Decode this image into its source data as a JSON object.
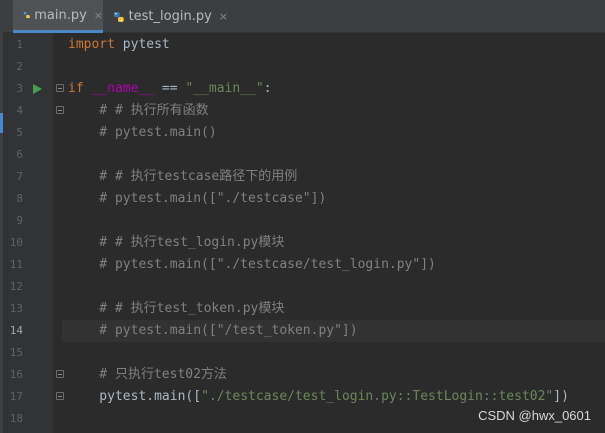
{
  "tabs": [
    {
      "label": "main.py",
      "close": "×",
      "icon": "python-file-icon",
      "active": true
    },
    {
      "label": "test_login.py",
      "close": "×",
      "icon": "python-file-icon",
      "active": false
    }
  ],
  "lines": [
    {
      "n": "1",
      "segs": [
        [
          "kw",
          "import"
        ],
        [
          "t",
          " pytest"
        ]
      ]
    },
    {
      "n": "2",
      "segs": []
    },
    {
      "n": "3",
      "segs": [
        [
          "kw",
          "if"
        ],
        [
          "t",
          " "
        ],
        [
          "dn",
          "__name__"
        ],
        [
          "t",
          " == "
        ],
        [
          "st",
          "\"__main__\""
        ],
        [
          "t",
          ":"
        ]
      ],
      "run": true,
      "fold": true
    },
    {
      "n": "4",
      "segs": [
        [
          "cm",
          "    # # 执行所有函数"
        ]
      ],
      "fold": true
    },
    {
      "n": "5",
      "segs": [
        [
          "cm",
          "    # pytest.main()"
        ]
      ]
    },
    {
      "n": "6",
      "segs": []
    },
    {
      "n": "7",
      "segs": [
        [
          "cm",
          "    # # 执行testcase路径下的用例"
        ]
      ]
    },
    {
      "n": "8",
      "segs": [
        [
          "cm",
          "    # pytest.main([\"./testcase\"])"
        ]
      ]
    },
    {
      "n": "9",
      "segs": []
    },
    {
      "n": "10",
      "segs": [
        [
          "cm",
          "    # # 执行test_login.py模块"
        ]
      ]
    },
    {
      "n": "11",
      "segs": [
        [
          "cm",
          "    # pytest.main([\"./testcase/test_login.py\"])"
        ]
      ]
    },
    {
      "n": "12",
      "segs": []
    },
    {
      "n": "13",
      "segs": [
        [
          "cm",
          "    # # 执行test_token.py模块"
        ]
      ]
    },
    {
      "n": "14",
      "segs": [
        [
          "cm",
          "    # pytest.main([\"/test_token.py\"])"
        ]
      ],
      "current": true
    },
    {
      "n": "15",
      "segs": []
    },
    {
      "n": "16",
      "segs": [
        [
          "cm",
          "    # 只执行test02方法"
        ]
      ],
      "fold": true
    },
    {
      "n": "17",
      "segs": [
        [
          "t",
          "    pytest.main(["
        ],
        [
          "st",
          "\"./testcase/test_login.py::TestLogin::test02\""
        ],
        [
          "t",
          "])"
        ]
      ],
      "fold": true
    },
    {
      "n": "18",
      "segs": []
    }
  ],
  "watermark": "CSDN @hwx_0601",
  "colors": {
    "keyword": "#cc7832",
    "comment": "#808080",
    "string": "#6a8759",
    "dunder": "#b200b2",
    "default": "#a9b7c6",
    "run": "#499c54",
    "tab_accent": "#4a88c7"
  }
}
